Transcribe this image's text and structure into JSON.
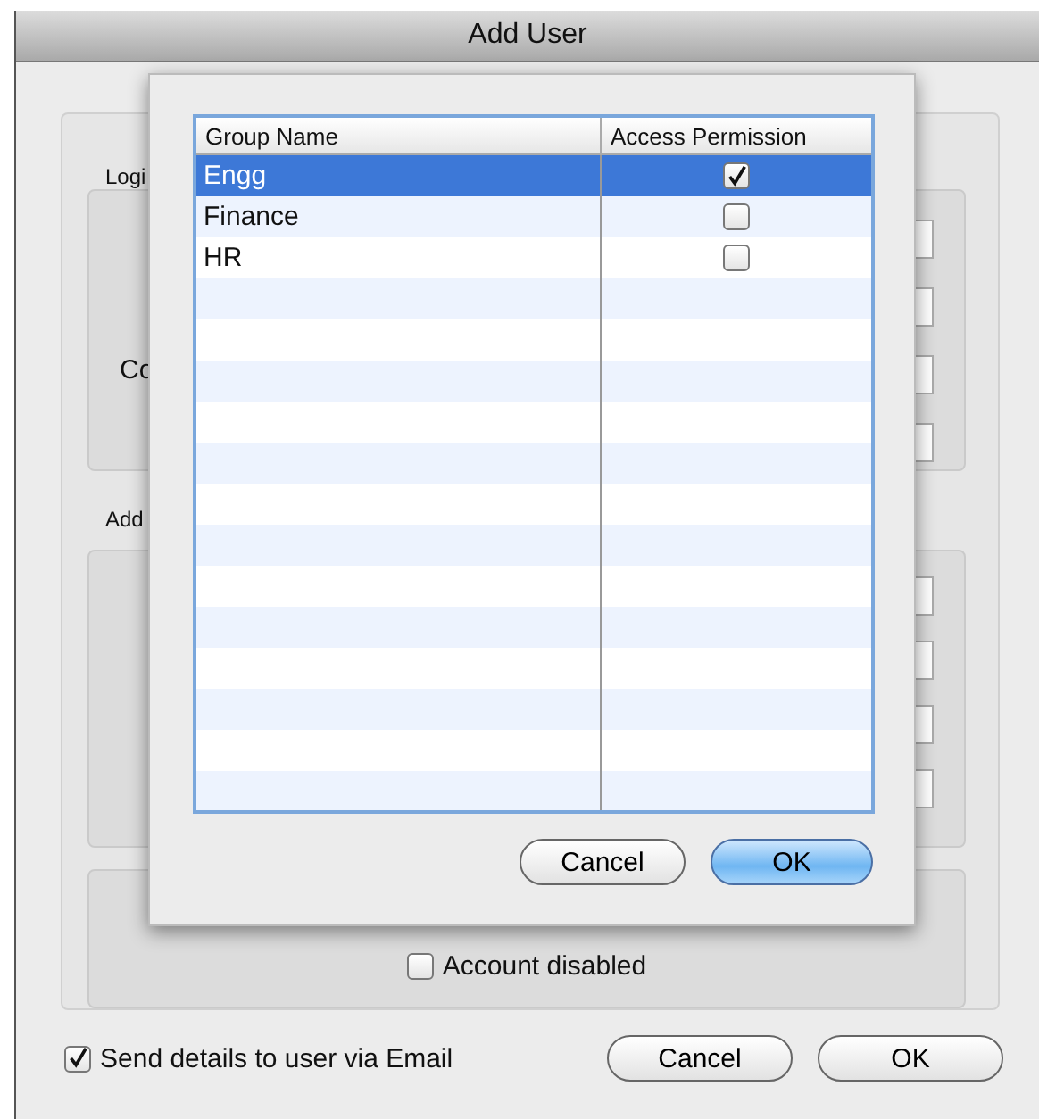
{
  "window": {
    "title": "Add User"
  },
  "background_form": {
    "login_group_label": "Logi",
    "login_field_label": "Co",
    "address_group_label": "Add",
    "account_disabled": {
      "label": "Account disabled",
      "checked": false
    }
  },
  "send_email": {
    "label": "Send details to user via Email",
    "checked": true
  },
  "buttons": [
    {
      "label": "Cancel",
      "default": false
    },
    {
      "label": "OK",
      "default": false
    }
  ],
  "group_sheet": {
    "columns": [
      "Group Name",
      "Access Permission"
    ],
    "rows": [
      {
        "name": "Engg",
        "selected": true,
        "access": true
      },
      {
        "name": "Finance",
        "selected": false,
        "access": false
      },
      {
        "name": "HR",
        "selected": false,
        "access": false
      }
    ],
    "buttons": [
      {
        "label": "Cancel",
        "default": false
      },
      {
        "label": "OK",
        "default": true
      }
    ]
  }
}
